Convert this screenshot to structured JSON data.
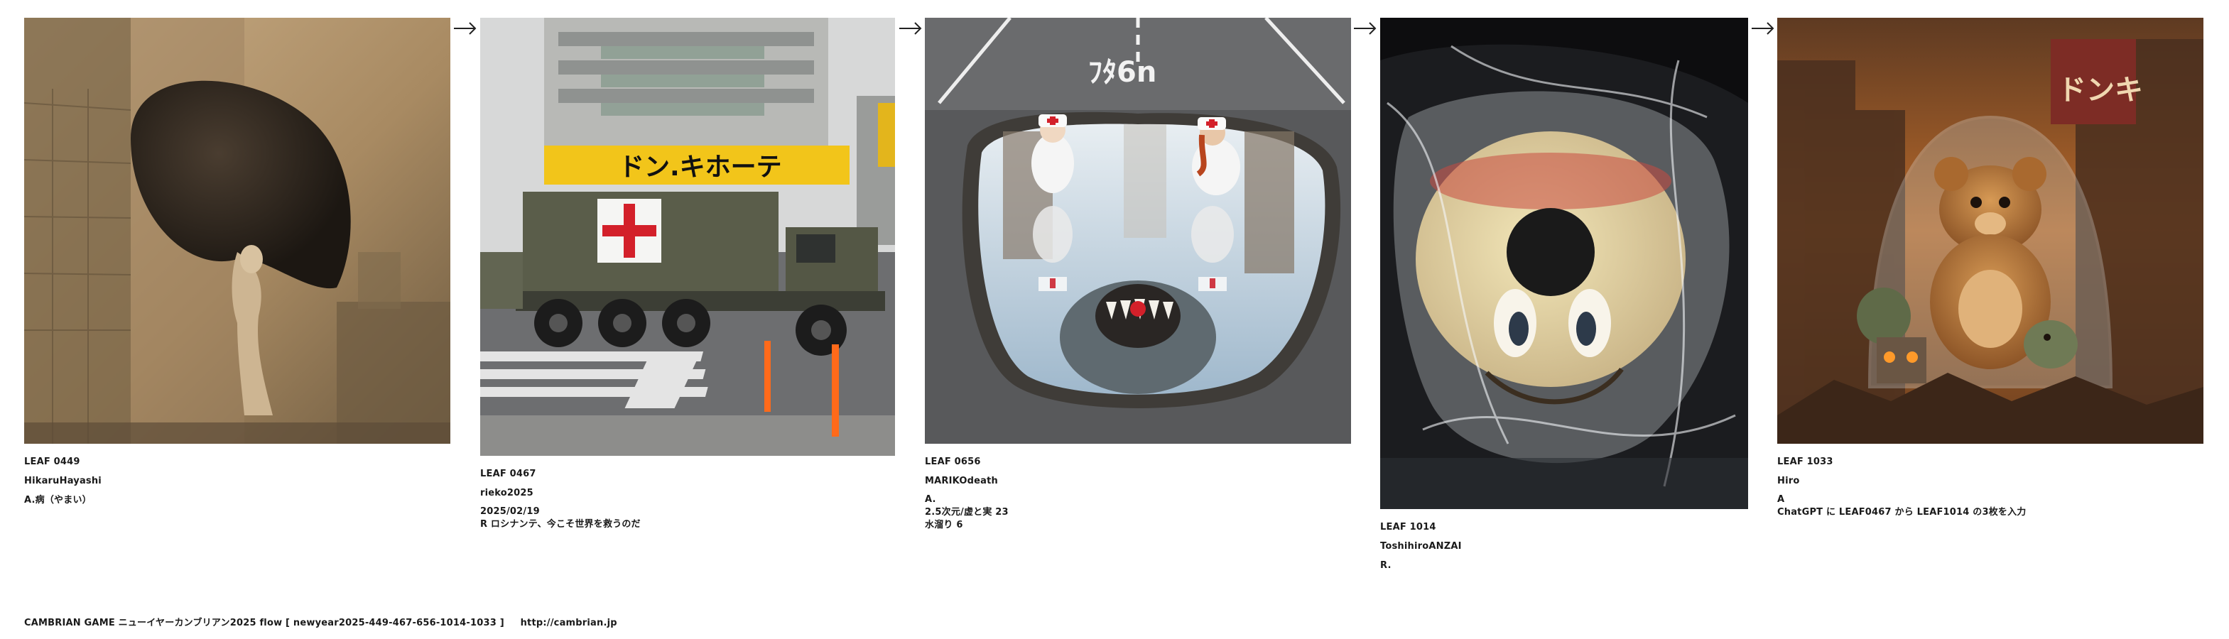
{
  "works": [
    {
      "leaf_id": "LEAF 0449",
      "author": "HikaruHayashi",
      "lines": [
        "A.病（やまい）"
      ],
      "image_alt": "sepia surreal figure beneath a giant dark balloon-like shape"
    },
    {
      "leaf_id": "LEAF 0467",
      "author": "rieko2025",
      "lines": [
        "2025/02/19",
        "R ロシナンテ、今こそ世界を救うのだ"
      ],
      "image_alt": "military truck with red cross in front of a Don Quijote store",
      "sign_text": "ドン.キホーテ"
    },
    {
      "leaf_id": "LEAF 0656",
      "author": "MARIKOdeath",
      "lines": [
        "A.",
        "2.5次元/虚と実 23",
        "水溜り 6"
      ],
      "image_alt": "two nurses looking into a puddle with a monster reflection on a road",
      "road_text": "ﾌﾀ6n"
    },
    {
      "leaf_id": "LEAF 1014",
      "author": "ToshihiroANZAI",
      "lines": [
        "R."
      ],
      "image_alt": "smiling face toy wrapped in plastic"
    },
    {
      "leaf_id": "LEAF 1033",
      "author": "Hiro",
      "lines": [
        "A",
        "ChatGPT に LEAF0467 から LEAF1014 の3枚を入力"
      ],
      "image_alt": "teddy bear under a glass dome in a ruined city",
      "sign_text": "ドンキ"
    }
  ],
  "footer": {
    "title": "CAMBRIAN GAME  ニューイヤーカンブリアン2025  flow [ newyear2025-449-467-656-1014-1033 ]",
    "url": "http://cambrian.jp"
  },
  "colors": {
    "background": "#ffffff",
    "text": "#1a1a1a",
    "sepia": "#a98a63",
    "red_cross": "#d3202a",
    "store_yellow": "#f2c51a",
    "amber": "#b8692a"
  },
  "icons": [
    "right-arrow-icon"
  ]
}
